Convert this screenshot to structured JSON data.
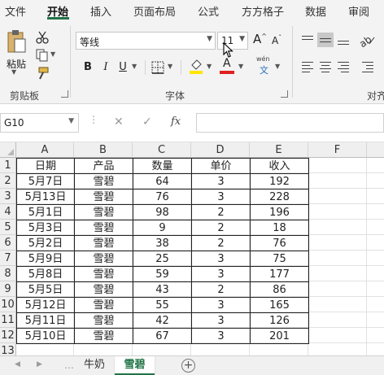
{
  "ribbon_tabs": [
    "文件",
    "开始",
    "插入",
    "页面布局",
    "公式",
    "方方格子",
    "数据",
    "审阅"
  ],
  "active_tab": "开始",
  "clipboard": {
    "paste_label": "粘贴",
    "group_label": "剪贴板"
  },
  "font": {
    "font_name": "等线",
    "font_size": "11",
    "bold": "B",
    "italic": "I",
    "underline": "U",
    "grow": "A",
    "shrink": "A",
    "font_color_glyph": "A",
    "phonetic_top": "wén",
    "phonetic_bottom": "文",
    "group_label": "字体"
  },
  "alignment": {
    "group_label": "对齐"
  },
  "formula_bar": {
    "name_box": "G10",
    "fx_label": "fx",
    "formula": ""
  },
  "columns": [
    "A",
    "B",
    "C",
    "D",
    "E",
    "F"
  ],
  "rows": [
    "1",
    "2",
    "3",
    "4",
    "5",
    "6",
    "7",
    "8",
    "9",
    "10",
    "11",
    "12",
    "13"
  ],
  "table": {
    "headers": [
      "日期",
      "产品",
      "数量",
      "单价",
      "收入"
    ],
    "rows": [
      [
        "5月7日",
        "雪碧",
        "64",
        "3",
        "192"
      ],
      [
        "5月13日",
        "雪碧",
        "76",
        "3",
        "228"
      ],
      [
        "5月1日",
        "雪碧",
        "98",
        "2",
        "196"
      ],
      [
        "5月3日",
        "雪碧",
        "9",
        "2",
        "18"
      ],
      [
        "5月2日",
        "雪碧",
        "38",
        "2",
        "76"
      ],
      [
        "5月9日",
        "雪碧",
        "25",
        "3",
        "75"
      ],
      [
        "5月8日",
        "雪碧",
        "59",
        "3",
        "177"
      ],
      [
        "5月5日",
        "雪碧",
        "43",
        "2",
        "86"
      ],
      [
        "5月12日",
        "雪碧",
        "55",
        "3",
        "165"
      ],
      [
        "5月11日",
        "雪碧",
        "42",
        "3",
        "126"
      ],
      [
        "5月10日",
        "雪碧",
        "67",
        "3",
        "201"
      ]
    ]
  },
  "sheets": [
    "牛奶",
    "雪碧"
  ],
  "active_sheet": "雪碧",
  "add_sheet_glyph": "+",
  "colors": {
    "accent": "#217346",
    "highlight": "#ffe600",
    "font_color": "#e02020"
  }
}
